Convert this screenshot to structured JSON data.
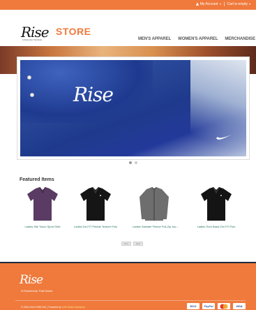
{
  "topbar": {
    "account": "My Account",
    "cart": "Cart is empty"
  },
  "header": {
    "logo": "Rise",
    "logo_tagline": "A Partnership That Works",
    "store_title": "STORE",
    "nav": [
      "MEN'S APPAREL",
      "WOMEN'S APPAREL",
      "MERCHANDISE"
    ]
  },
  "hero": {
    "logo": "Rise",
    "slides": 2,
    "active_slide": 1
  },
  "featured": {
    "title": "Featured Items",
    "products": [
      {
        "name": "Ladies Silk Touch Sport Shirt",
        "color": "#5a3b63"
      },
      {
        "name": "Ladies Dri-FIT Pebble Texture Polo",
        "color": "#151515"
      },
      {
        "name": "Ladies Sweater Fleece Full-Zip Jac...",
        "color": "#6e6e6e"
      },
      {
        "name": "Ladies Tech Basic Dri-FIT Polo",
        "color": "#141414"
      }
    ],
    "pager": {
      "prev": "Prev",
      "next": "Next"
    }
  },
  "footer": {
    "logo": "Rise",
    "tagline": "A Partnership That Works",
    "copyright": "© 2004-2014 RISE INC | Powered by",
    "powered_by": "OAS Sister Solutions",
    "payments": [
      "DCO",
      "PayPal",
      "MC",
      "VISA"
    ]
  },
  "colors": {
    "accent": "#ef7a3c",
    "link": "#1f6f5f",
    "footer_border": "#1f2c3a"
  }
}
